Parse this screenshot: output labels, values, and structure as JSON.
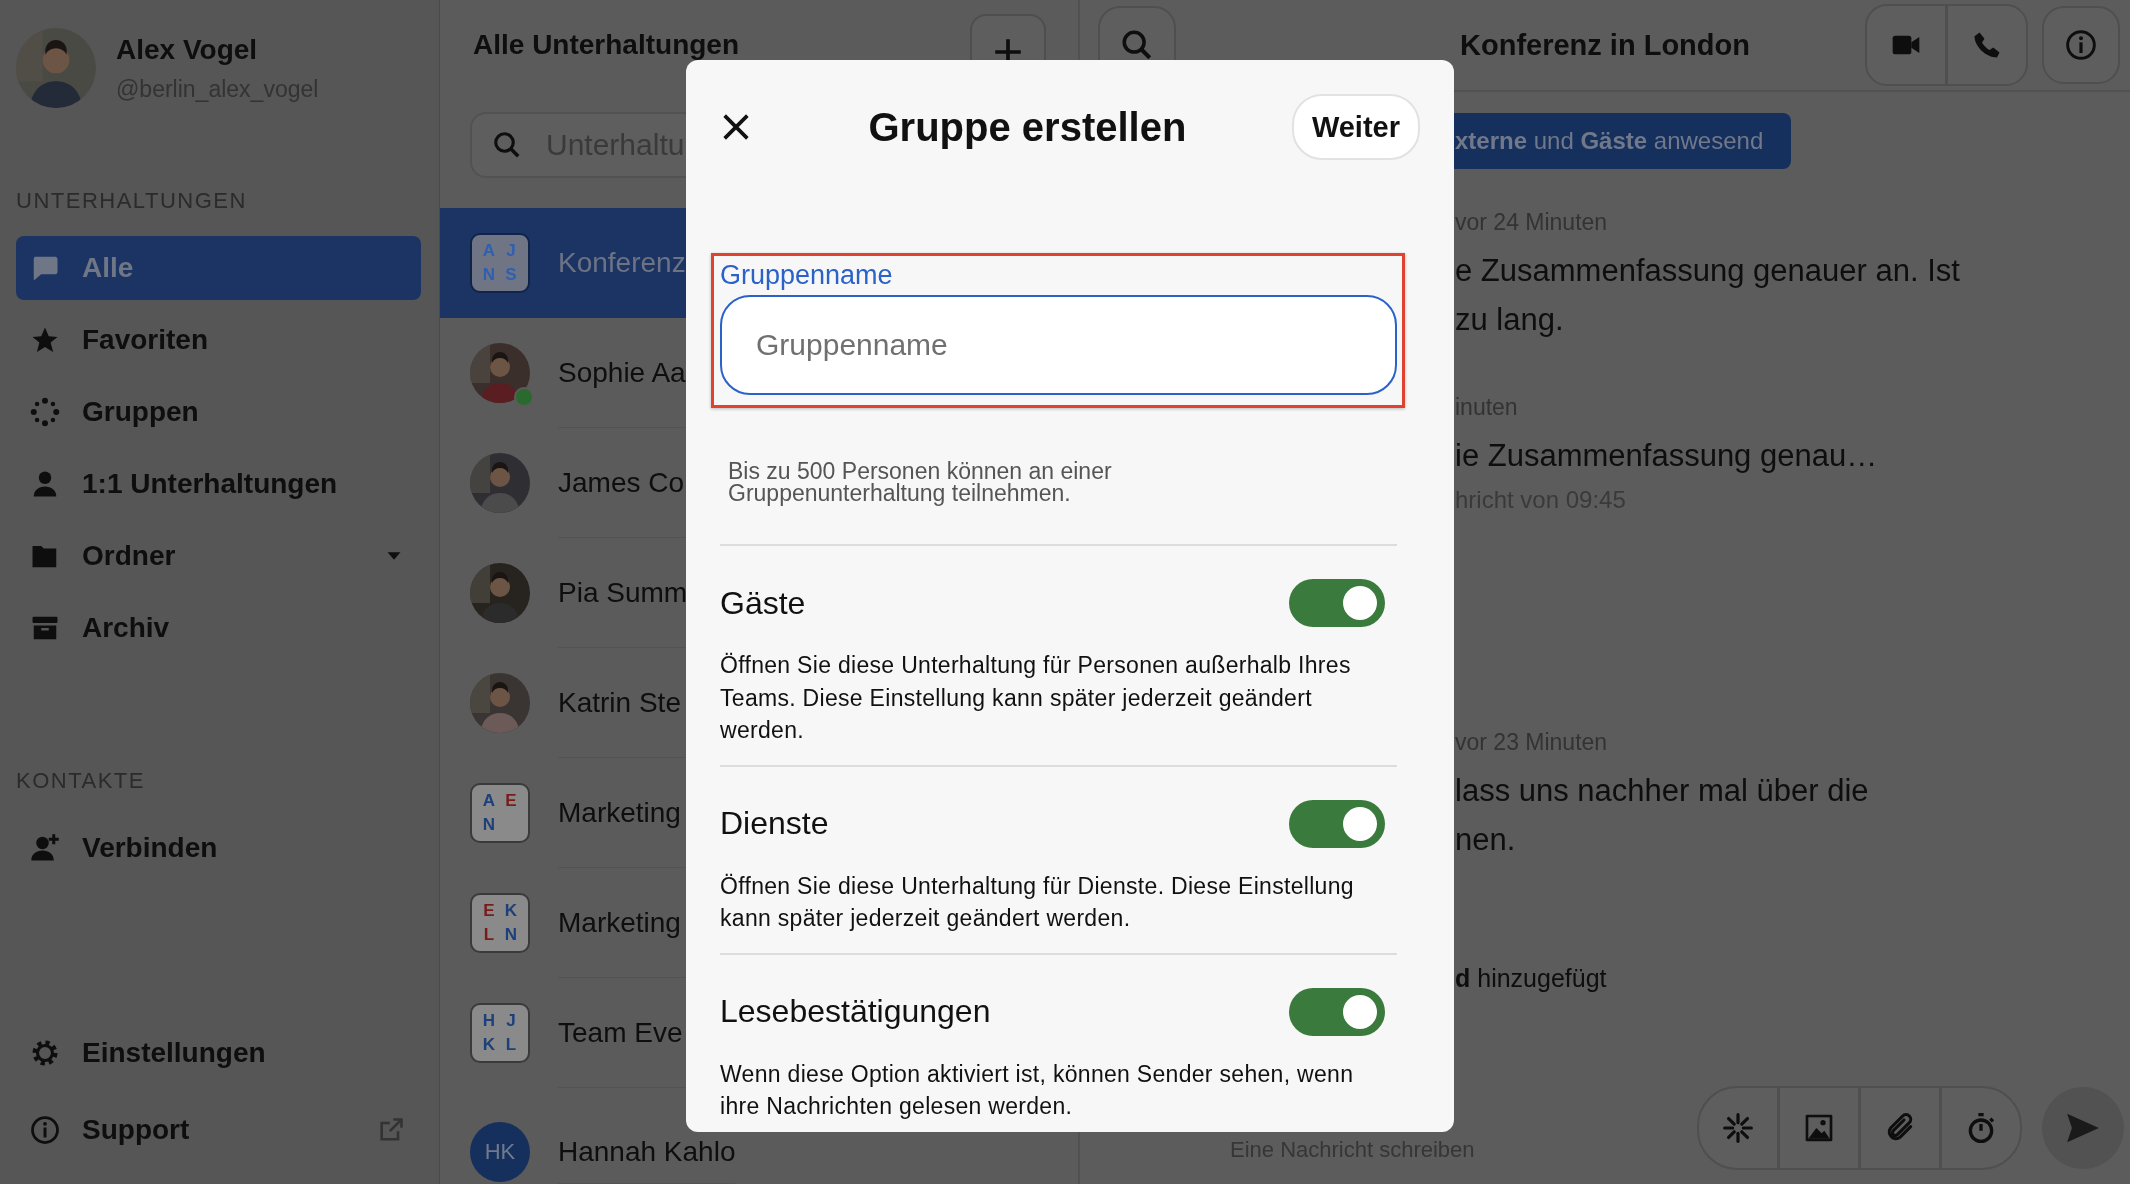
{
  "profile": {
    "name": "Alex Vogel",
    "handle": "@berlin_alex_vogel"
  },
  "sidebar": {
    "sections": [
      {
        "heading": "UNTERHALTUNGEN",
        "items": [
          {
            "label": "Alle",
            "selected": true,
            "dropdown": false
          },
          {
            "label": "Favoriten",
            "selected": false,
            "dropdown": false
          },
          {
            "label": "Gruppen",
            "selected": false,
            "dropdown": false
          },
          {
            "label": "1:1 Unterhaltungen",
            "selected": false,
            "dropdown": false
          },
          {
            "label": "Ordner",
            "selected": false,
            "dropdown": true
          },
          {
            "label": "Archiv",
            "selected": false,
            "dropdown": false
          }
        ]
      },
      {
        "heading": "KONTAKTE",
        "items": [
          {
            "label": "Verbinden",
            "selected": false,
            "dropdown": false
          }
        ]
      }
    ],
    "footer": [
      {
        "label": "Einstellungen",
        "external": false
      },
      {
        "label": "Support",
        "external": true
      }
    ]
  },
  "conversations": {
    "title": "Alle Unterhaltungen",
    "search": {
      "placeholder": "Unterhaltu"
    },
    "items": [
      {
        "name": "Konferenz",
        "selected": true,
        "avatar": {
          "kind": "group",
          "letters": [
            {
              "text": "A",
              "color": "#2f5fb0"
            },
            {
              "text": "J",
              "color": "#2f5fb0"
            },
            {
              "text": "N",
              "color": "#2f5fb0"
            },
            {
              "text": "S",
              "color": "#2f5fb0"
            }
          ]
        }
      },
      {
        "name": "Sophie Aa",
        "selected": false,
        "avatar": {
          "kind": "picture",
          "online": true
        }
      },
      {
        "name": "James Co",
        "selected": false,
        "avatar": {
          "kind": "picture",
          "online": false
        }
      },
      {
        "name": "Pia Summ",
        "selected": false,
        "avatar": {
          "kind": "picture",
          "online": false
        }
      },
      {
        "name": "Katrin Ste",
        "selected": false,
        "avatar": {
          "kind": "picture",
          "online": false
        }
      },
      {
        "name": "Marketing",
        "selected": false,
        "avatar": {
          "kind": "group",
          "letters": [
            {
              "text": "A",
              "color": "#1d3f7a"
            },
            {
              "text": "E",
              "color": "#7a1a1a"
            },
            {
              "text": "N",
              "color": "#1d3f7a"
            }
          ]
        }
      },
      {
        "name": "Marketing",
        "selected": false,
        "avatar": {
          "kind": "group",
          "letters": [
            {
              "text": "E",
              "color": "#7a1a1a"
            },
            {
              "text": "K",
              "color": "#1d3f7a"
            },
            {
              "text": "L",
              "color": "#7a1a1a"
            },
            {
              "text": "N",
              "color": "#1d3f7a"
            }
          ]
        }
      },
      {
        "name": "Team Eve",
        "selected": false,
        "avatar": {
          "kind": "group",
          "letters": [
            {
              "text": "H",
              "color": "#1d3f7a"
            },
            {
              "text": "J",
              "color": "#1d3f7a"
            },
            {
              "text": "K",
              "color": "#1d3f7a"
            },
            {
              "text": "L",
              "color": "#1d3f7a"
            }
          ]
        }
      },
      {
        "name": "Hannah Kahlo",
        "selected": false,
        "avatar": {
          "kind": "initials",
          "text": "HK"
        }
      }
    ]
  },
  "chat": {
    "title": "Konferenz in London",
    "banner": "**xterne** und **Gäste** anwesend",
    "messages": [
      {
        "kind": "message",
        "time": "vor 24 Minuten",
        "lines": [
          "e Zusammenfassung genauer an. Ist",
          "zu lang."
        ]
      },
      {
        "kind": "message",
        "time": "inuten",
        "lines": [
          "ie Zusammenfassung genau…"
        ],
        "note": "hricht von 09:45"
      },
      {
        "kind": "message",
        "time": "vor 23 Minuten",
        "lines": [
          "lass uns nachher mal über die",
          "nen."
        ]
      },
      {
        "kind": "system",
        "text": "**d** hinzugefügt"
      }
    ],
    "composer": {
      "placeholder": "Eine Nachricht schreiben"
    }
  },
  "dialog": {
    "title": "Gruppe erstellen",
    "next_button": "Weiter",
    "field": {
      "label": "Gruppenname",
      "placeholder": "Gruppenname",
      "focused": true,
      "highlighted": true
    },
    "hint": "Bis zu 500 Personen können an einer Gruppenunterhaltung teilnehmen.",
    "settings": [
      {
        "title": "Gäste",
        "description": "Öffnen Sie diese Unterhaltung für Personen außerhalb Ihres Teams. Diese Einstellung kann später jederzeit geändert werden.",
        "on": true
      },
      {
        "title": "Dienste",
        "description": "Öffnen Sie diese Unterhaltung für Dienste. Diese Einstellung kann später jederzeit geändert werden.",
        "on": true
      },
      {
        "title": "Lesebestätigungen",
        "description": "Wenn diese Option aktiviert ist, können Sender sehen, wenn ihre Nachrichten gelesen werden.",
        "on": true
      }
    ]
  }
}
